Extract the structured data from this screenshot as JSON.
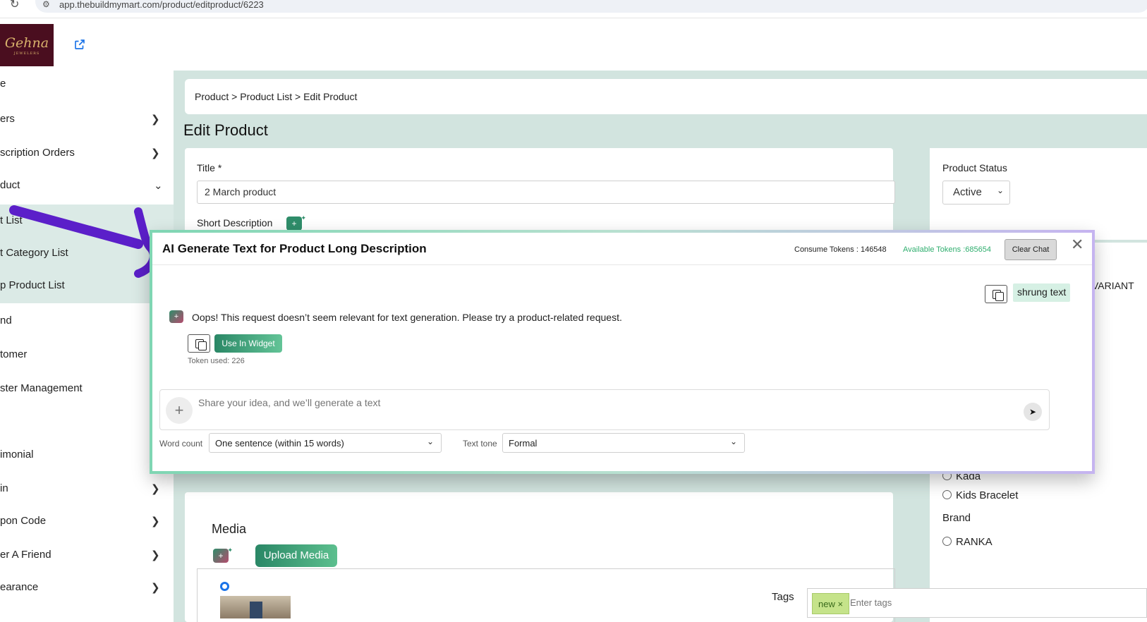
{
  "browser": {
    "url": "app.thebuildmymart.com/product/editproduct/6223"
  },
  "header": {
    "logo_text": "Gehna",
    "logo_sub": "JEWELERS"
  },
  "sidebar": {
    "items": [
      {
        "label": "e"
      },
      {
        "label": "ers"
      },
      {
        "label": "scription Orders"
      },
      {
        "label": "duct"
      },
      {
        "label": "t List"
      },
      {
        "label": "t Category List"
      },
      {
        "label": "p Product List"
      },
      {
        "label": "nd"
      },
      {
        "label": "tomer"
      },
      {
        "label": "ster Management"
      },
      {
        "label": "imonial"
      },
      {
        "label": "in"
      },
      {
        "label": "pon Code"
      },
      {
        "label": "er A Friend"
      },
      {
        "label": "earance"
      }
    ]
  },
  "main": {
    "breadcrumb": "Product > Product List > Edit Product",
    "page_title": "Edit Product",
    "title_label": "Title *",
    "title_value": "2 March product",
    "short_desc_label": "Short Description",
    "product_status_label": "Product Status",
    "product_status_value": "Active",
    "variant_fragment": "VARIANT",
    "t_fragment": "t",
    "categories": [
      "Kada",
      "Kids Bracelet"
    ],
    "brand_label": "Brand",
    "brands": [
      "RANKA"
    ],
    "tags_label": "Tags",
    "tags": [
      "new"
    ],
    "tags_placeholder": "Enter tags",
    "media_label": "Media",
    "upload_label": "Upload Media"
  },
  "modal": {
    "title": "AI Generate Text for Product Long Description",
    "consume_tokens": "Consume Tokens : 146548",
    "available_tokens": "Available Tokens :685654",
    "clear_chat": "Clear Chat",
    "user_message": "shrung text",
    "bot_message": "Oops! This request doesn’t seem relevant for text generation. Please try a product-related request.",
    "use_in_widget": "Use In Widget",
    "token_used": "Token used: 226",
    "prompt_placeholder": "Share your idea, and we’ll generate a text",
    "word_count_label": "Word count",
    "word_count_value": "One sentence (within 15 words)",
    "text_tone_label": "Text tone",
    "text_tone_value": "Formal"
  },
  "colors": {
    "accent": "#2f8d6a",
    "main_bg": "#d2e4df",
    "available_green": "#2fae6e",
    "annotation": "#5b1fc9"
  }
}
